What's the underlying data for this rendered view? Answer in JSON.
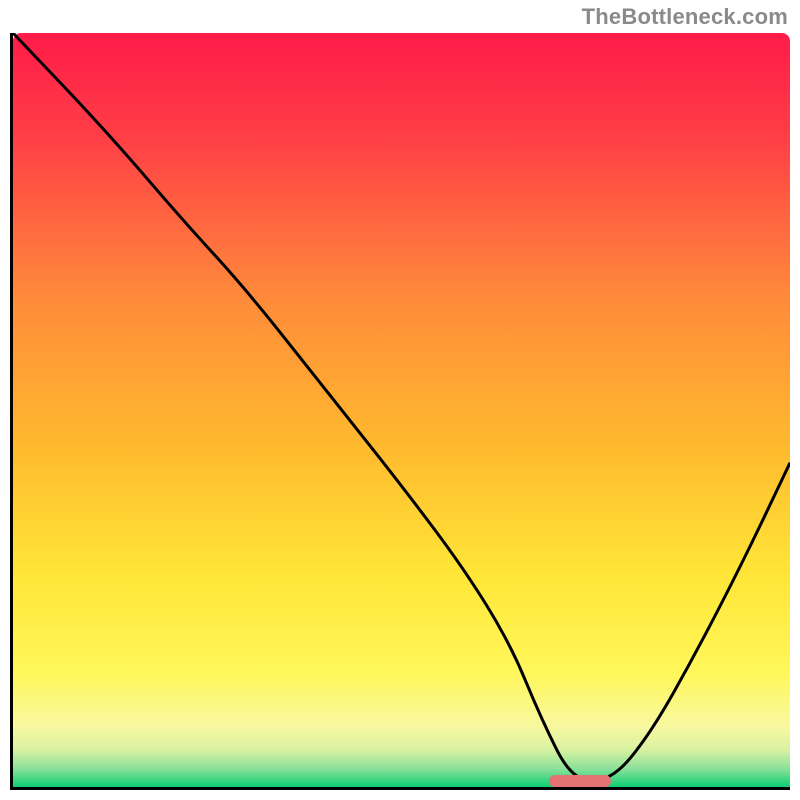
{
  "watermark": {
    "text": "TheBottleneck.com"
  },
  "gradient": {
    "stops": [
      {
        "pct": 0,
        "color": "#ff1b49"
      },
      {
        "pct": 14,
        "color": "#ff3f46"
      },
      {
        "pct": 35,
        "color": "#ff8a3a"
      },
      {
        "pct": 55,
        "color": "#ffba2e"
      },
      {
        "pct": 72,
        "color": "#ffe637"
      },
      {
        "pct": 85,
        "color": "#fff75b"
      },
      {
        "pct": 92,
        "color": "#f8f8a0"
      },
      {
        "pct": 95,
        "color": "#d9f2a1"
      },
      {
        "pct": 97.5,
        "color": "#8ee19a"
      },
      {
        "pct": 100,
        "color": "#0ccf72"
      }
    ]
  },
  "marker": {
    "left_pct": 69,
    "right_pct": 77,
    "y_pct": 99.2
  },
  "chart_data": {
    "type": "line",
    "title": "",
    "xlabel": "",
    "ylabel": "",
    "xlim": [
      0,
      100
    ],
    "ylim": [
      0,
      100
    ],
    "series": [
      {
        "name": "bottleneck-curve",
        "x": [
          0,
          12,
          22,
          30,
          40,
          50,
          58,
          64,
          68,
          72,
          77,
          82,
          88,
          94,
          100
        ],
        "y": [
          100,
          87,
          75,
          66,
          53,
          40,
          29,
          19,
          9,
          0.8,
          0.8,
          7,
          18,
          30,
          43
        ]
      }
    ],
    "annotations": [
      {
        "name": "optimal-range-marker",
        "x_start": 69,
        "x_end": 77,
        "y": 0.8
      }
    ]
  }
}
